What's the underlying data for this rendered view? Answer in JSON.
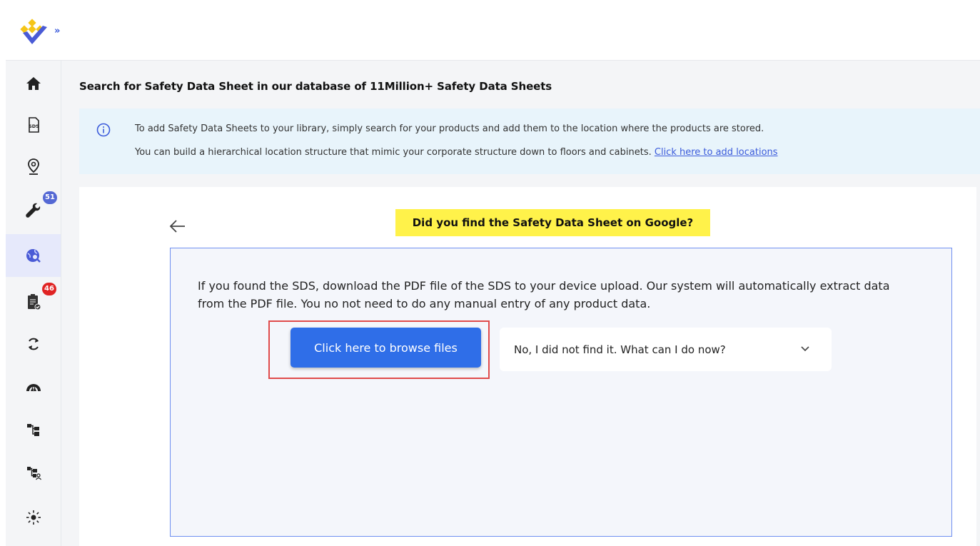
{
  "app": {
    "brand_colors": {
      "primary": "#2f6ee8",
      "accent_yellow": "#f5c518",
      "badge_blue": "#5468d4",
      "badge_red": "#e02424"
    }
  },
  "sidebar": {
    "items": [
      {
        "id": "home",
        "icon": "home-icon"
      },
      {
        "id": "sds",
        "icon": "sds-document-icon"
      },
      {
        "id": "locations",
        "icon": "location-pin-icon"
      },
      {
        "id": "tools",
        "icon": "wrench-icon",
        "badge": "51"
      },
      {
        "id": "search",
        "icon": "globe-search-icon",
        "active": true
      },
      {
        "id": "tasks",
        "icon": "clipboard-check-icon",
        "badge": "46"
      },
      {
        "id": "sync",
        "icon": "sync-icon"
      },
      {
        "id": "alerts",
        "icon": "warning-dome-icon"
      },
      {
        "id": "hierarchy",
        "icon": "hierarchy-icon"
      },
      {
        "id": "hierarchy-user",
        "icon": "hierarchy-user-icon"
      },
      {
        "id": "sun",
        "icon": "sun-icon"
      }
    ]
  },
  "main": {
    "title": "Search for Safety Data Sheet in our database of 11Million+ Safety Data Sheets",
    "info": {
      "line1": "To add Safety Data Sheets to your library, simply search for your products and add them to the location where the products are stored.",
      "line2": "You can build a hierarchical location structure that mimic your corporate structure down to floors and cabinets.",
      "link": "Click here to add locations"
    },
    "question": "Did you find the Safety Data Sheet on Google?",
    "panel_text": "If you found the SDS, download the PDF file of the SDS to your device upload. Our system will automatically extract data from the PDF file. You no not need to do any manual entry of any product data.",
    "browse_button": "Click here to browse files",
    "dropdown_label": "No, I did not find it. What can I do now?"
  }
}
